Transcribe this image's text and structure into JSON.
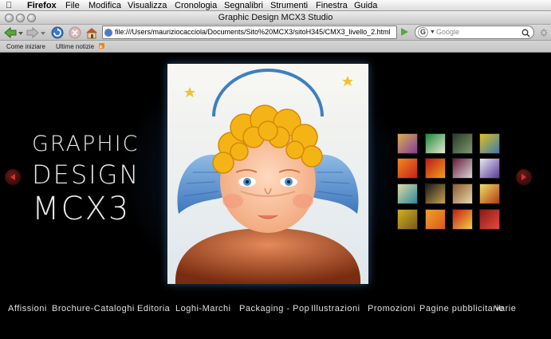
{
  "menubar": {
    "app": "Firefox",
    "items": [
      "File",
      "Modifica",
      "Visualizza",
      "Cronologia",
      "Segnalibri",
      "Strumenti",
      "Finestra",
      "Guida"
    ]
  },
  "window": {
    "title": "Graphic Design MCX3 Studio"
  },
  "toolbar": {
    "url": "file:///Users/mauriziocacciola/Documents/Sito%20MCX3/sitoH345/CMX3_livello_2.html",
    "search_placeholder": "Google"
  },
  "bookmarks": {
    "items": [
      "Come iniziare",
      "Ultime notizie"
    ]
  },
  "site": {
    "logo": [
      "GRAPHIC",
      "DESIGN",
      "MCX3"
    ],
    "nav": [
      "Affissioni",
      "Brochure-Cataloghi",
      "Editoria",
      "Loghi-Marchi",
      "Packaging - Pop",
      "Illustrazioni",
      "Promozioni",
      "Pagine pubblicitarie",
      "Varie"
    ]
  },
  "colors": {
    "accent_glow": "#3c82c8",
    "background": "#000000",
    "arrow_button": "#6a1a1a"
  }
}
